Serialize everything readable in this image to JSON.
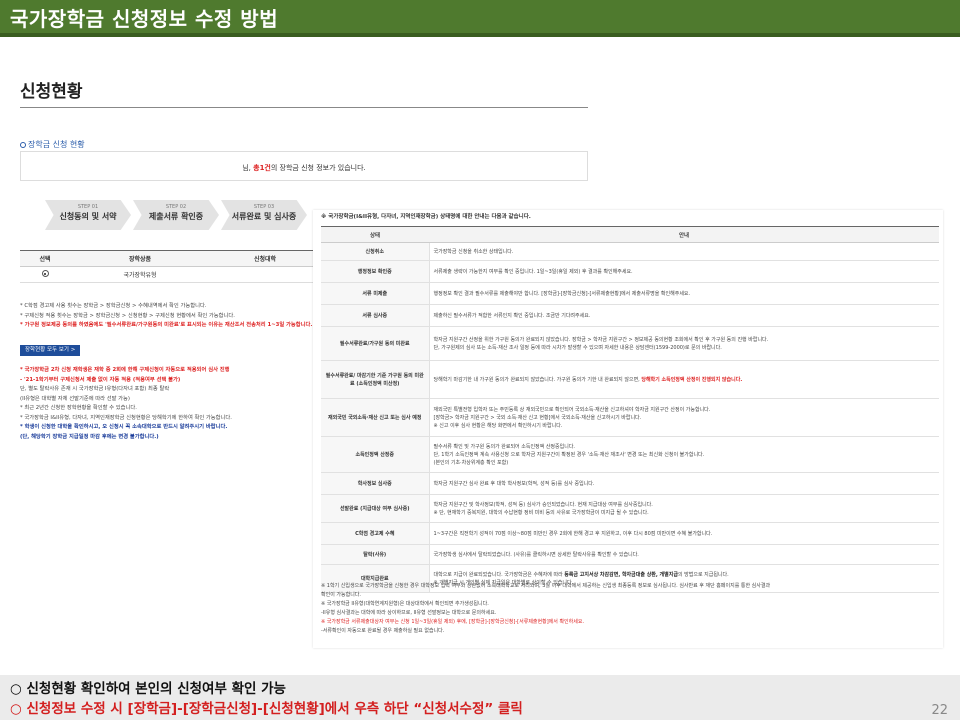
{
  "title": "국가장학금 신청정보 수정 방법",
  "page_heading": "신청현황",
  "sub_link": "장학금 신청 현황",
  "notice": {
    "prefix": "님, ",
    "count": "총1건",
    "suffix": "의 장학금 신청 정보가 있습니다."
  },
  "steps": [
    {
      "num": "STEP 01",
      "label": "신청동의 및 서약"
    },
    {
      "num": "STEP 02",
      "label": "제출서류 확인중"
    },
    {
      "num": "STEP 03",
      "label": "서류완료 및 심사중"
    }
  ],
  "selection_table": {
    "headers": [
      "선택",
      "장학상품",
      "신청대학"
    ],
    "rows": [
      {
        "product": "국가장학유형"
      }
    ]
  },
  "left_notes": [
    "* C학점 경고제 사용 횟수는 장학금 > 장학금신청 > 수혜내역에서 확인 가능합니다.",
    "* 구제신청 적용 횟수는 장학금 > 장학금신청 > 신청현황 > 구제신청 현황에서 확인 가능합니다."
  ],
  "left_red_note": "* 가구원 정보제공 동의를 하였음에도 '필수서류완료/가구원동의 미완료'로 표시되는 이유는 재산조서 전송처리 1~3일 가능합니다.",
  "left_button": "장학현황 모두 보기 >",
  "left_notes_2": [
    {
      "text": "* 국가장학금 2차 신청 재학생은 재학 중 2회에 한해 구제신청이 자동으로 적용되어 심사 진행",
      "style": "red"
    },
    {
      "text": "- '21-1학기부터 구제신청서 제출 없이 자동 적용 (적용여부 선택 불가)",
      "style": "red"
    },
    {
      "text": "단, 별도 탈락사유 존재 시 국가장학금 I유형(다자녀 포함) 최종 탈락",
      "style": "plain"
    },
    {
      "text": "(II유형은 대학별 자체 선발기준에 따라 선발 가능)",
      "style": "plain"
    },
    {
      "text": "* 최근 2년간 신청한 장학현황을 확인할 수 있습니다.",
      "style": "plain"
    },
    {
      "text": "* 국가장학금 I&II유형, 다자녀, 지역인재장학금 신청현황은 당해학기에 한하여 확인 가능합니다.",
      "style": "plain"
    },
    {
      "text": "* 학생이 신청한 대학을 확인하시고, 오 신청시 꼭 소속대학으로 반드시 알려주시기 바랍니다.",
      "style": "blue"
    },
    {
      "text": "(단, 해당학기 장학금 지급일정 마감 후에는 변경 불가합니다.)",
      "style": "blue"
    }
  ],
  "overlay": {
    "title": "※ 국가장학금(I&II유형, 다자녀, 지역인재장학금) 상태명에 대한 안내는 다음과 같습니다.",
    "headers": [
      "상태",
      "안내"
    ],
    "rows": [
      {
        "state": "신청취소",
        "desc": "국가장학금 신청을 취소한 상태입니다."
      },
      {
        "state": "행정정보 확인중",
        "desc": "서류제출 생략이 가능한지 여부를 확인 중입니다. 1일~3일(휴일 제외) 후 결과를 확인해주세요."
      },
      {
        "state": "서류 미제출",
        "desc": "행정정보 확인 결과 필수서류를 제출해야만 합니다. [장학금]-[장학금신청]-[서류제출현황]에서 제출서류명을 확인해주세요."
      },
      {
        "state": "서류 심사중",
        "desc": "제출하신 필수서류가 적합한 서류인지 확인 중입니다. 조금만 기다려주세요."
      },
      {
        "state": "필수서류완료/가구원 동의 미완료",
        "desc": "학자금 지원구간 산정을 위한 가구원 동의가 완료되지 않았습니다. 장학금 > 학자금 지원구간 > 정보제공 동의현황 조회에서 확인 후 가구원 동의 진행 바랍니다.",
        "desc2": "단, 가구원제의 심사 또는 소득·재산 조사 일정 등에 따라 시차가 발생할 수 있으며 자세한 내용은 상담센터(1599-2000)로 문의 바랍니다."
      },
      {
        "state": "필수서류완료/ 마감기한 기준 가구원 동의 미완료 (소득인정액 미산정)",
        "desc": "당해학기 마감기한 내 가구원 동의가 완료되지 않았습니다. 가구원 동의가 기한 내 완료되지 않으면, ",
        "desc_red": "당해학기 소득인정액 산정이 진행되지 않습니다."
      },
      {
        "state": "재외국민 국외소득·재산 신고 또는 심사 예정",
        "desc": "재외국민 특별전형 입학자 또는 주민등록 상 재외국민으로 확인되어 국외소득·재산을 신고하셔야 학자금 지원구간 산정이 가능합니다.",
        "desc2": "[장학금> 학자금 지원구간 > 국외 소득·재산 신고 현황]에서 국외소득·재산을 신고하시기 바랍니다.",
        "desc3": "※ 신고 이후 심사 현황은 해당 화면에서 확인하시기 바랍니다."
      },
      {
        "state": "소득인정액 산정중",
        "desc": "필수서류 확인 및 가구원 동의가 완료되어 소득인정액 산정중입니다.",
        "desc2": "단, 1학기 소득인정액 계속 사용신청 으로 학자금 지원구간이 확정된 경우 '소득·재산 재조사' 변경 또는 최신화 신청이 불가합니다.",
        "desc3": "(본인의 기초·차상위계층 확인 포함)"
      },
      {
        "state": "학사정보 심사중",
        "desc": "학자금 지원구간 심사 완료 후 대학 학사정보(학적, 성적 등)를 심사 중입니다."
      },
      {
        "state": "선발완료 (지급대상 여부 심사중)",
        "desc": "학자금 지원구간 및 학사정보(학적, 성적 등) 심사가 승인되었습니다. 현재 지급대상 여부를 심사중입니다.",
        "desc2": "※ 단, 현재학기 중복지원, 대학의 수납현황 정비 미비 등의 사유로 국가장학금이 미지급 될 수 있습니다."
      },
      {
        "state": "C학점 경고제 수혜",
        "desc": "1~3구간은 직전학기 성적이 70점 이상~80점 미만인 경우 2회에 한해 경고 후 지원하고, 이후 다시 80점 미만이면 수혜 불가합니다."
      },
      {
        "state": "탈락(사유)",
        "desc": "국가장학생 심사에서 탈락되었습니다. (사유)를 클릭하시면 상세한 탈락사유를 확인할 수 있습니다."
      },
      {
        "state": "대학지급완료",
        "desc": "대학으로 지급이 완료되었습니다. 국가장학금은 수혜자에 따라 ",
        "desc_bold": "등록금 고지서상 차감감면, 학자금대출 상환, 개별지급",
        "desc_after": "의 방법으로 지급됩니다.",
        "desc2": "※ 개별지급 시 개인별 실제 지급일은 대학별로 상이할 수 있습니다."
      }
    ],
    "notes": [
      {
        "text": "※ 1학기 신입생으로 국가장학금을 신청한 경우 대학정보 입력 여부와 상관없이 소속대학학교로 처리되며, 3월 이후 대학에서 제공하는 신입생 최종등록 정보로 심사됩니다. 심사반료 후 재단 홈페이지를 통한 심사결과",
        "style": "plain"
      },
      {
        "text": "확인이 가능합니다.",
        "style": "plain"
      },
      {
        "text": "※ 국가장학금 II유형(대학연계지원형)은 대상대학에서 확인되면 추가생성됩니다.",
        "style": "plain"
      },
      {
        "text": "-II유형 심사결과는 대학에 따라 상이하므로, II유형 선발정보는 대학으로 문의하세요.",
        "style": "plain"
      },
      {
        "text": "※ 국가장학금 서류제출대상자 여부는 신청 1일~3일(휴일 제외) 후에, [장학금]-[장학금신청]-[서류제출현황]에서 확인하세요.",
        "style": "red"
      },
      {
        "text": "-서류확인이 자동으로 완료될 경우 제출하실 필요 없습니다.",
        "style": "plain"
      }
    ]
  },
  "bottom": {
    "line1": "○ 신청현황 확인하여 본인의 신청여부 확인 가능",
    "line2": "○ 신청정보 수정 시 [장학금]-[장학금신청]-[신청현황]에서 우측 하단 “신청서수정” 클릭"
  },
  "page_number": "22",
  "colors": {
    "title_bar": "#4f7a2e",
    "accent_red": "#d31f1f",
    "link_blue": "#2a5caa"
  }
}
